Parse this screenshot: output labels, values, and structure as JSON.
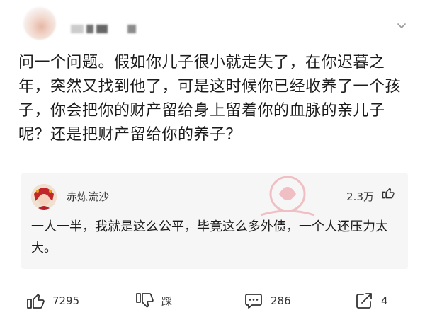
{
  "post": {
    "author_redacted": true,
    "question": "问一个问题。假如你儿子很小就走失了，在你迟暮之年，突然又找到他了，可是这时候你已经收养了一个孩子，你会把你的财产留给身上留着你的血脉的亲儿子呢？还是把财产留给你的养子？"
  },
  "top_comment": {
    "username": "赤炼流沙",
    "likes": "2.3万",
    "text": "一人一半，我就是这么公平，毕竟这么多外债，一个人还压力太大。"
  },
  "actions": {
    "like_count": "7295",
    "dislike_label": "踩",
    "comment_count": "286",
    "share_count": "4"
  },
  "colors": {
    "text": "#1b1b1b",
    "card_bg": "#f6f6f6",
    "icon": "#333333"
  }
}
